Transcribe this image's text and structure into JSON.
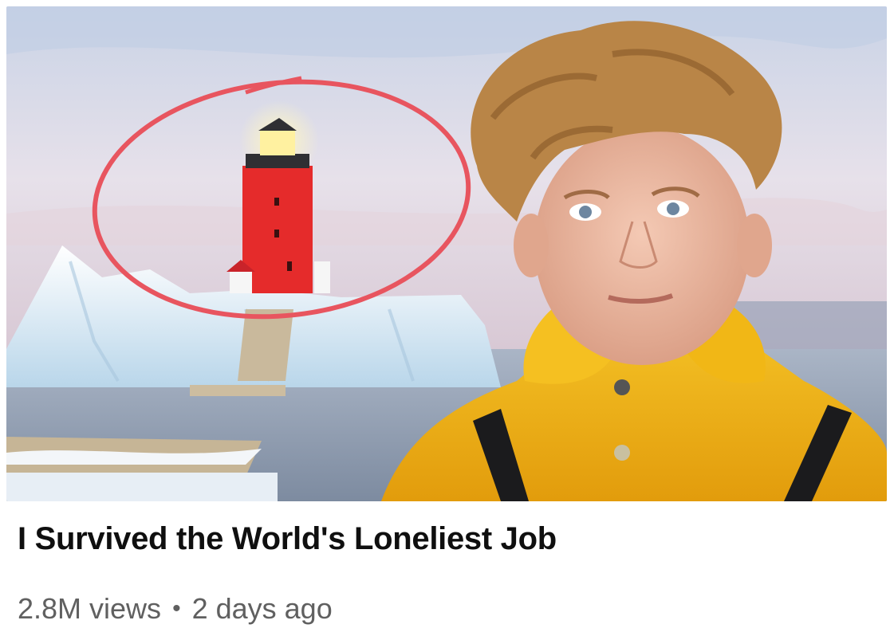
{
  "video": {
    "title": "I Survived the World's Loneliest Job",
    "views": "2.8M views",
    "separator": "•",
    "age": "2 days ago"
  },
  "thumbnail": {
    "subject": "lighthouse on iceberg with young man in yellow raincoat",
    "icons": [
      "lighthouse-icon",
      "iceberg-icon",
      "person-icon",
      "red-circle-annotation"
    ],
    "colors": {
      "sky": "#d9d6e6",
      "water": "#9aa9be",
      "ice": "#e8f1f8",
      "lighthouse": "#e52b2b",
      "raincoat": "#f2b418",
      "annotation": "#e8555f"
    }
  }
}
